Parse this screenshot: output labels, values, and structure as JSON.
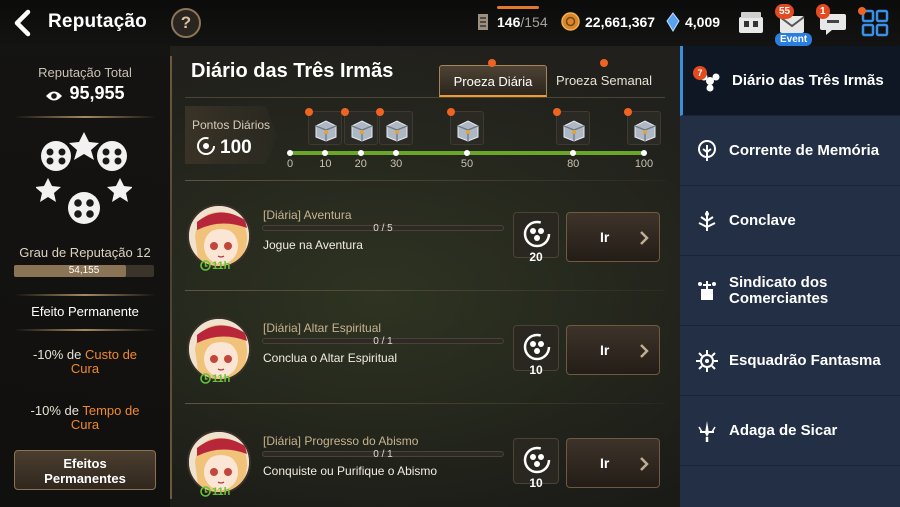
{
  "header": {
    "title": "Reputação",
    "help_label": "?",
    "stamina_current": "146",
    "stamina_max": "/154",
    "gold": "22,661,367",
    "crystals": "4,009",
    "mail_badge": "55",
    "mail_event_tag": "Event",
    "chat_badge": "1"
  },
  "left": {
    "total_label": "Reputação Total",
    "total_value": "95,955",
    "grade_label": "Grau de Reputação 12",
    "grade_progress_text": "54,155",
    "grade_progress_fraction": 0.8,
    "permanent_title": "Efeito Permanente",
    "effect1_prefix": "-10% de ",
    "effect1_line1": "Custo de",
    "effect1_line2": "Cura",
    "effect2_prefix": "-10% de ",
    "effect2_line1": "Tempo de",
    "effect2_line2": "Cura",
    "perm_button_line1": "Efeitos",
    "perm_button_line2": "Permanentes"
  },
  "center": {
    "title": "Diário das Três Irmãs",
    "tab_daily": "Proeza Diária",
    "tab_weekly": "Proeza Semanal",
    "points_label": "Pontos Diários",
    "points_value": "100",
    "milestones": [
      "0",
      "10",
      "20",
      "30",
      "50",
      "80",
      "100"
    ],
    "missions": [
      {
        "category": "[Diária] Aventura",
        "progress": "0 / 5",
        "description": "Jogue na Aventura",
        "time": "11h",
        "reward": "20",
        "go_label": "Ir"
      },
      {
        "category": "[Diária] Altar Espiritual",
        "progress": "0 / 1",
        "description": "Conclua o Altar Espiritual",
        "time": "11h",
        "reward": "10",
        "go_label": "Ir"
      },
      {
        "category": "[Diária] Progresso do Abismo",
        "progress": "0 / 1",
        "description": "Conquiste ou Purifique o Abismo",
        "time": "11h",
        "reward": "10",
        "go_label": "Ir"
      }
    ]
  },
  "right": {
    "items": [
      {
        "label": "Diário das Três Irmãs",
        "badge": "7",
        "icon": "flower-emblem-icon"
      },
      {
        "label": "Corrente de Memória",
        "icon": "tree-icon"
      },
      {
        "label": "Conclave",
        "icon": "ornate-tree-icon"
      },
      {
        "label": "Sindicato dos Comerciantes",
        "icon": "merchant-icon"
      },
      {
        "label": "Esquadrão Fantasma",
        "icon": "phantom-sun-icon"
      },
      {
        "label": "Adaga de Sicar",
        "icon": "dagger-icon"
      }
    ]
  },
  "colors": {
    "accent_orange": "#f08a2c",
    "progress_green": "#6aa628",
    "right_panel": "#222f44",
    "notification_red": "#e24a20"
  }
}
